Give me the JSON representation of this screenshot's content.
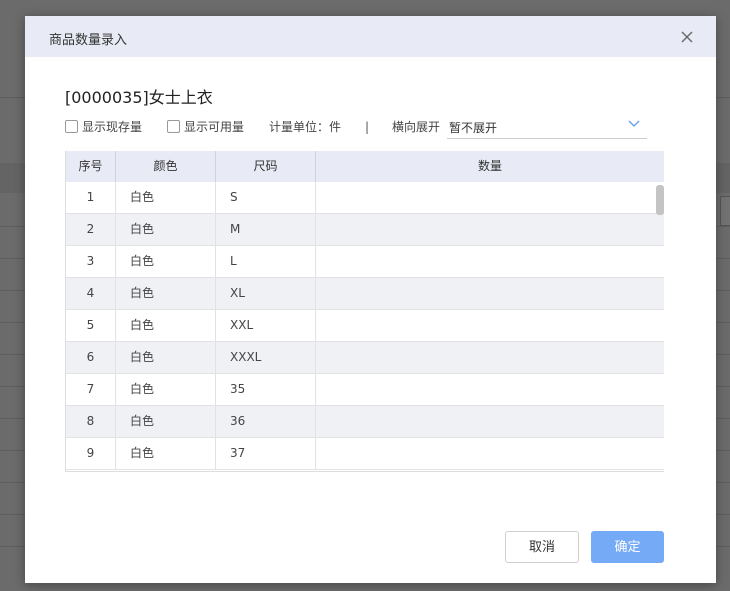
{
  "dialog": {
    "title": "商品数量录入",
    "product_title": "[0000035]女士上衣"
  },
  "options": {
    "show_stock_label": "显示现存量",
    "show_available_label": "显示可用量",
    "unit_text": "计量单位：件",
    "separator": "|",
    "expand_label": "横向展开",
    "expand_value": "暂不展开"
  },
  "table": {
    "headers": [
      "序号",
      "颜色",
      "尺码",
      "数量"
    ],
    "rows": [
      {
        "no": "1",
        "color": "白色",
        "size": "S",
        "qty": ""
      },
      {
        "no": "2",
        "color": "白色",
        "size": "M",
        "qty": ""
      },
      {
        "no": "3",
        "color": "白色",
        "size": "L",
        "qty": ""
      },
      {
        "no": "4",
        "color": "白色",
        "size": "XL",
        "qty": ""
      },
      {
        "no": "5",
        "color": "白色",
        "size": "XXL",
        "qty": ""
      },
      {
        "no": "6",
        "color": "白色",
        "size": "XXXL",
        "qty": ""
      },
      {
        "no": "7",
        "color": "白色",
        "size": "35",
        "qty": ""
      },
      {
        "no": "8",
        "color": "白色",
        "size": "36",
        "qty": ""
      },
      {
        "no": "9",
        "color": "白色",
        "size": "37",
        "qty": ""
      }
    ]
  },
  "buttons": {
    "cancel": "取消",
    "ok": "确定"
  },
  "icons": {
    "close": "close-icon",
    "dropdown": "chevron-down-icon"
  },
  "colors": {
    "header_bg": "#e8ebf5",
    "primary": "#74aaf6",
    "row_alt": "#f0f1f5"
  }
}
